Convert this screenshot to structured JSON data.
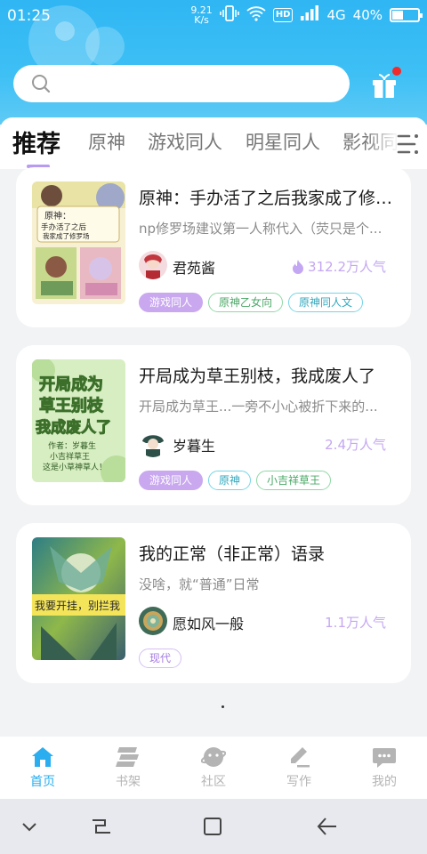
{
  "status_bar": {
    "time": "01:25",
    "net_speed_value": "9.21",
    "net_speed_unit": "K/s",
    "hd": "HD",
    "network": "4G",
    "battery": "40%",
    "battery_level": 0.4
  },
  "search": {
    "placeholder": ""
  },
  "header": {
    "gift_icon": "gift-icon",
    "gift_badge_color": "#f12a2a"
  },
  "tabs": [
    {
      "label": "推荐",
      "active": true
    },
    {
      "label": "原神"
    },
    {
      "label": "游戏同人"
    },
    {
      "label": "明星同人"
    },
    {
      "label": "影视同人"
    }
  ],
  "books": [
    {
      "title": "原神：手办活了之后我家成了修罗场",
      "desc": "np修罗场建议第一人称代入（荧只是个...",
      "author": "君苑酱",
      "popularity": "312.2万人气",
      "hot": true,
      "tags": [
        {
          "label": "游戏同人",
          "style": "purple"
        },
        {
          "label": "原神乙女向",
          "style": "green"
        },
        {
          "label": "原神同人文",
          "style": "cyan"
        }
      ]
    },
    {
      "title": "开局成为草王别枝，我成废人了",
      "desc": "开局成为草王...一旁不小心被折下来的...",
      "author": "岁暮生",
      "popularity": "2.4万人气",
      "hot": false,
      "tags": [
        {
          "label": "游戏同人",
          "style": "purple"
        },
        {
          "label": "原神",
          "style": "cyan"
        },
        {
          "label": "小吉祥草王",
          "style": "green"
        }
      ]
    },
    {
      "title": "我的正常（非正常）语录",
      "desc": "没啥，就“普通”日常",
      "author": "愿如风一般",
      "popularity": "1.1万人气",
      "hot": false,
      "cover_banner": "我要开挂，别拦我",
      "tags": [
        {
          "label": "现代",
          "style": "violet"
        }
      ]
    }
  ],
  "covers": {
    "book1": {
      "line1": "原神：",
      "line2": "手办活了之后",
      "line3": "我家成了修罗场"
    },
    "book2": {
      "line1": "开局成为",
      "line2": "草王别枝",
      "line3": "我成废人了",
      "line4": "作者：岁暮生",
      "line5": "小吉祥草王",
      "line6": "这是小草神草人！"
    }
  },
  "bottom_nav": [
    {
      "label": "首页",
      "icon": "home-icon",
      "active": true
    },
    {
      "label": "书架",
      "icon": "bookshelf-icon"
    },
    {
      "label": "社区",
      "icon": "community-icon"
    },
    {
      "label": "写作",
      "icon": "write-icon"
    },
    {
      "label": "我的",
      "icon": "profile-icon"
    }
  ],
  "colors": {
    "header": "#2fb6f3",
    "accent": "#2aaef0",
    "tag_purple": "#c9a8ef",
    "popularity": "#c4a7f2"
  }
}
